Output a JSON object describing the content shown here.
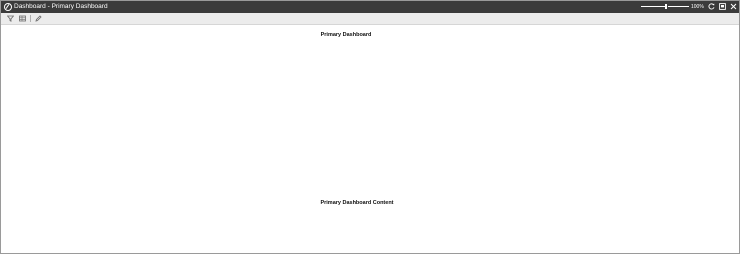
{
  "window": {
    "title": "Dashboard - Primary Dashboard",
    "zoom": "100%"
  },
  "toolbar": {
    "tools": [
      {
        "name": "filter-icon"
      },
      {
        "name": "table-icon"
      },
      {
        "name": "pencil-icon"
      }
    ]
  },
  "dashboard": {
    "heading": "Primary Dashboard",
    "content_label": "Primary Dashboard Content"
  },
  "colors": {
    "titlebar": "#3b3b3b",
    "toolbar": "#ececec",
    "background": "#ffffff"
  }
}
